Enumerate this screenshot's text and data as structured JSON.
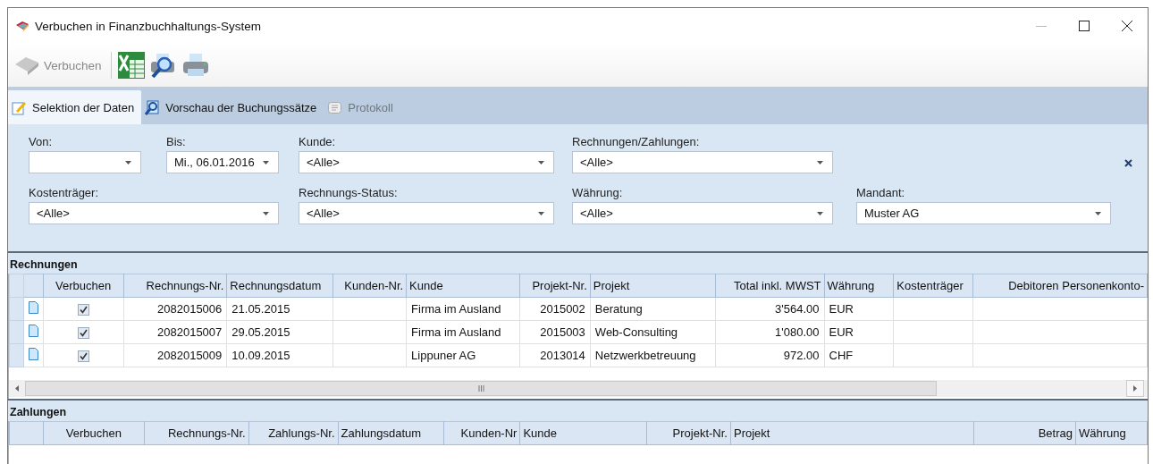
{
  "window": {
    "title": "Verbuchen in Finanzbuchhaltungs-System"
  },
  "toolbar": {
    "post_button": {
      "label": "Verbuchen",
      "disabled": true
    }
  },
  "tabs": [
    {
      "label": "Selektion der Daten",
      "selected": true,
      "disabled": false
    },
    {
      "label": "Vorschau der Buchungssätze",
      "selected": false,
      "disabled": false
    },
    {
      "label": "Protokoll",
      "selected": false,
      "disabled": true
    }
  ],
  "filters": [
    {
      "label": "Von:"
    },
    {
      "label": "Bis:",
      "value": "Mi., 06.01.2016"
    },
    {
      "label": "Kunde:",
      "value": "<Alle>"
    },
    {
      "label": "Rechnungen/Zahlungen:",
      "value": "<Alle>"
    },
    {
      "label": "Kostenträger:",
      "value": "<Alle>"
    },
    {
      "label": "Rechnungs-Status:",
      "value": "<Alle>"
    },
    {
      "label": "Währung:",
      "value": "<Alle>"
    },
    {
      "label": "Mandant:",
      "value": "Muster AG"
    }
  ],
  "invoices": {
    "title": "Rechnungen",
    "columns": [
      "Verbuchen",
      "Rechnungs-Nr.",
      "Rechnungsdatum",
      "Kunden-Nr.",
      "Kunde",
      "Projekt-Nr.",
      "Projekt",
      "Total inkl. MWST",
      "Währung",
      "Kostenträger",
      "Debitoren Personenkonto-"
    ],
    "rows": [
      {
        "cells": [
          {
            "checked": true
          },
          "2082015006",
          "21.05.2015",
          "",
          "Firma im Ausland",
          "2015002",
          "Beratung",
          "3'564.00",
          "EUR",
          "",
          ""
        ]
      },
      {
        "cells": [
          {
            "checked": true
          },
          "2082015007",
          "29.05.2015",
          "",
          "Firma im Ausland",
          "2015003",
          "Web-Consulting",
          "1'080.00",
          "EUR",
          "",
          ""
        ]
      },
      {
        "cells": [
          {
            "checked": true
          },
          "2082015009",
          "10.09.2015",
          "",
          "Lippuner AG",
          "2013014",
          "Netzwerkbetreuung",
          "972.00",
          "CHF",
          "",
          ""
        ]
      }
    ]
  },
  "payments": {
    "title": "Zahlungen",
    "columns": [
      "Verbuchen",
      "Rechnungs-Nr.",
      "Zahlungs-Nr.",
      "Zahlungsdatum",
      "Kunden-Nr",
      "Kunde",
      "Projekt-Nr.",
      "Projekt",
      "Betrag",
      "Währung"
    ]
  }
}
